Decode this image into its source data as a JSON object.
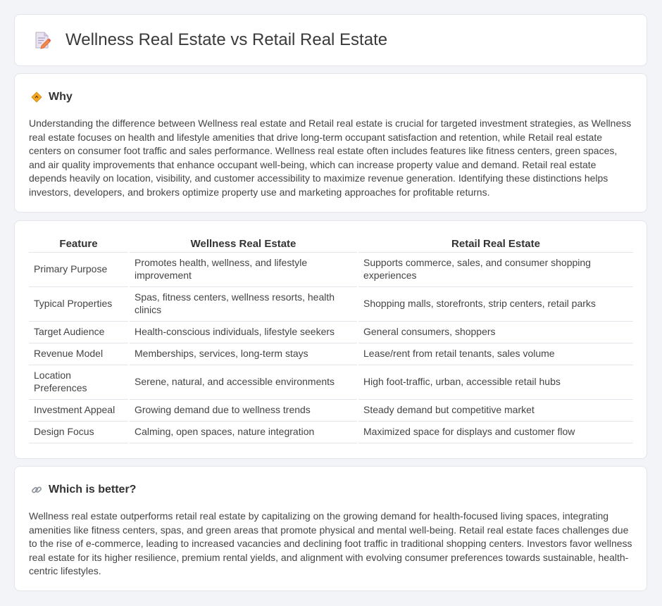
{
  "header": {
    "title": "Wellness Real Estate vs Retail Real Estate",
    "icon": "document-pencil-icon"
  },
  "why": {
    "icon": "diamond-sign-icon",
    "title": "Why",
    "body": "Understanding the difference between Wellness real estate and Retail real estate is crucial for targeted investment strategies, as Wellness real estate focuses on health and lifestyle amenities that drive long-term occupant satisfaction and retention, while Retail real estate centers on consumer foot traffic and sales performance. Wellness real estate often includes features like fitness centers, green spaces, and air quality improvements that enhance occupant well-being, which can increase property value and demand. Retail real estate depends heavily on location, visibility, and customer accessibility to maximize revenue generation. Identifying these distinctions helps investors, developers, and brokers optimize property use and marketing approaches for profitable returns."
  },
  "table": {
    "headers": [
      "Feature",
      "Wellness Real Estate",
      "Retail Real Estate"
    ],
    "rows": [
      [
        "Primary Purpose",
        "Promotes health, wellness, and lifestyle improvement",
        "Supports commerce, sales, and consumer shopping experiences"
      ],
      [
        "Typical Properties",
        "Spas, fitness centers, wellness resorts, health clinics",
        "Shopping malls, storefronts, strip centers, retail parks"
      ],
      [
        "Target Audience",
        "Health-conscious individuals, lifestyle seekers",
        "General consumers, shoppers"
      ],
      [
        "Revenue Model",
        "Memberships, services, long-term stays",
        "Lease/rent from retail tenants, sales volume"
      ],
      [
        "Location Preferences",
        "Serene, natural, and accessible environments",
        "High foot-traffic, urban, accessible retail hubs"
      ],
      [
        "Investment Appeal",
        "Growing demand due to wellness trends",
        "Steady demand but competitive market"
      ],
      [
        "Design Focus",
        "Calming, open spaces, nature integration",
        "Maximized space for displays and customer flow"
      ]
    ]
  },
  "better": {
    "icon": "link-icon",
    "title": "Which is better?",
    "body": "Wellness real estate outperforms retail real estate by capitalizing on the growing demand for health-focused living spaces, integrating amenities like fitness centers, spas, and green areas that promote physical and mental well-being. Retail real estate faces challenges due to the rise of e-commerce, leading to increased vacancies and declining foot traffic in traditional shopping centers. Investors favor wellness real estate for its higher resilience, premium rental yields, and alignment with evolving consumer preferences towards sustainable, health-centric lifestyles."
  }
}
